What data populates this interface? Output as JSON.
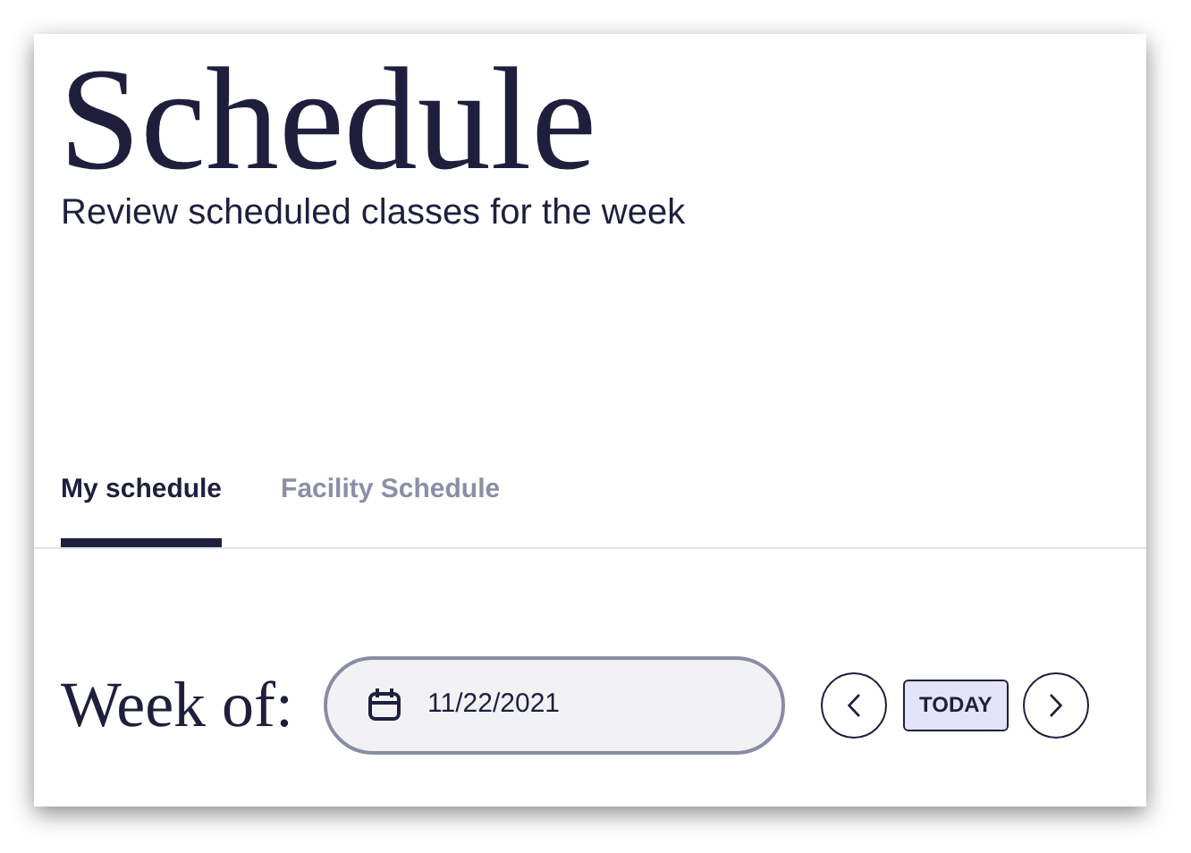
{
  "header": {
    "title": "Schedule",
    "subtitle": "Review scheduled classes for the week"
  },
  "tabs": [
    {
      "label": "My schedule",
      "selected": true
    },
    {
      "label": "Facility Schedule",
      "selected": false
    }
  ],
  "week": {
    "label": "Week of:",
    "date_value": "11/22/2021",
    "today_button": "TODAY"
  }
}
